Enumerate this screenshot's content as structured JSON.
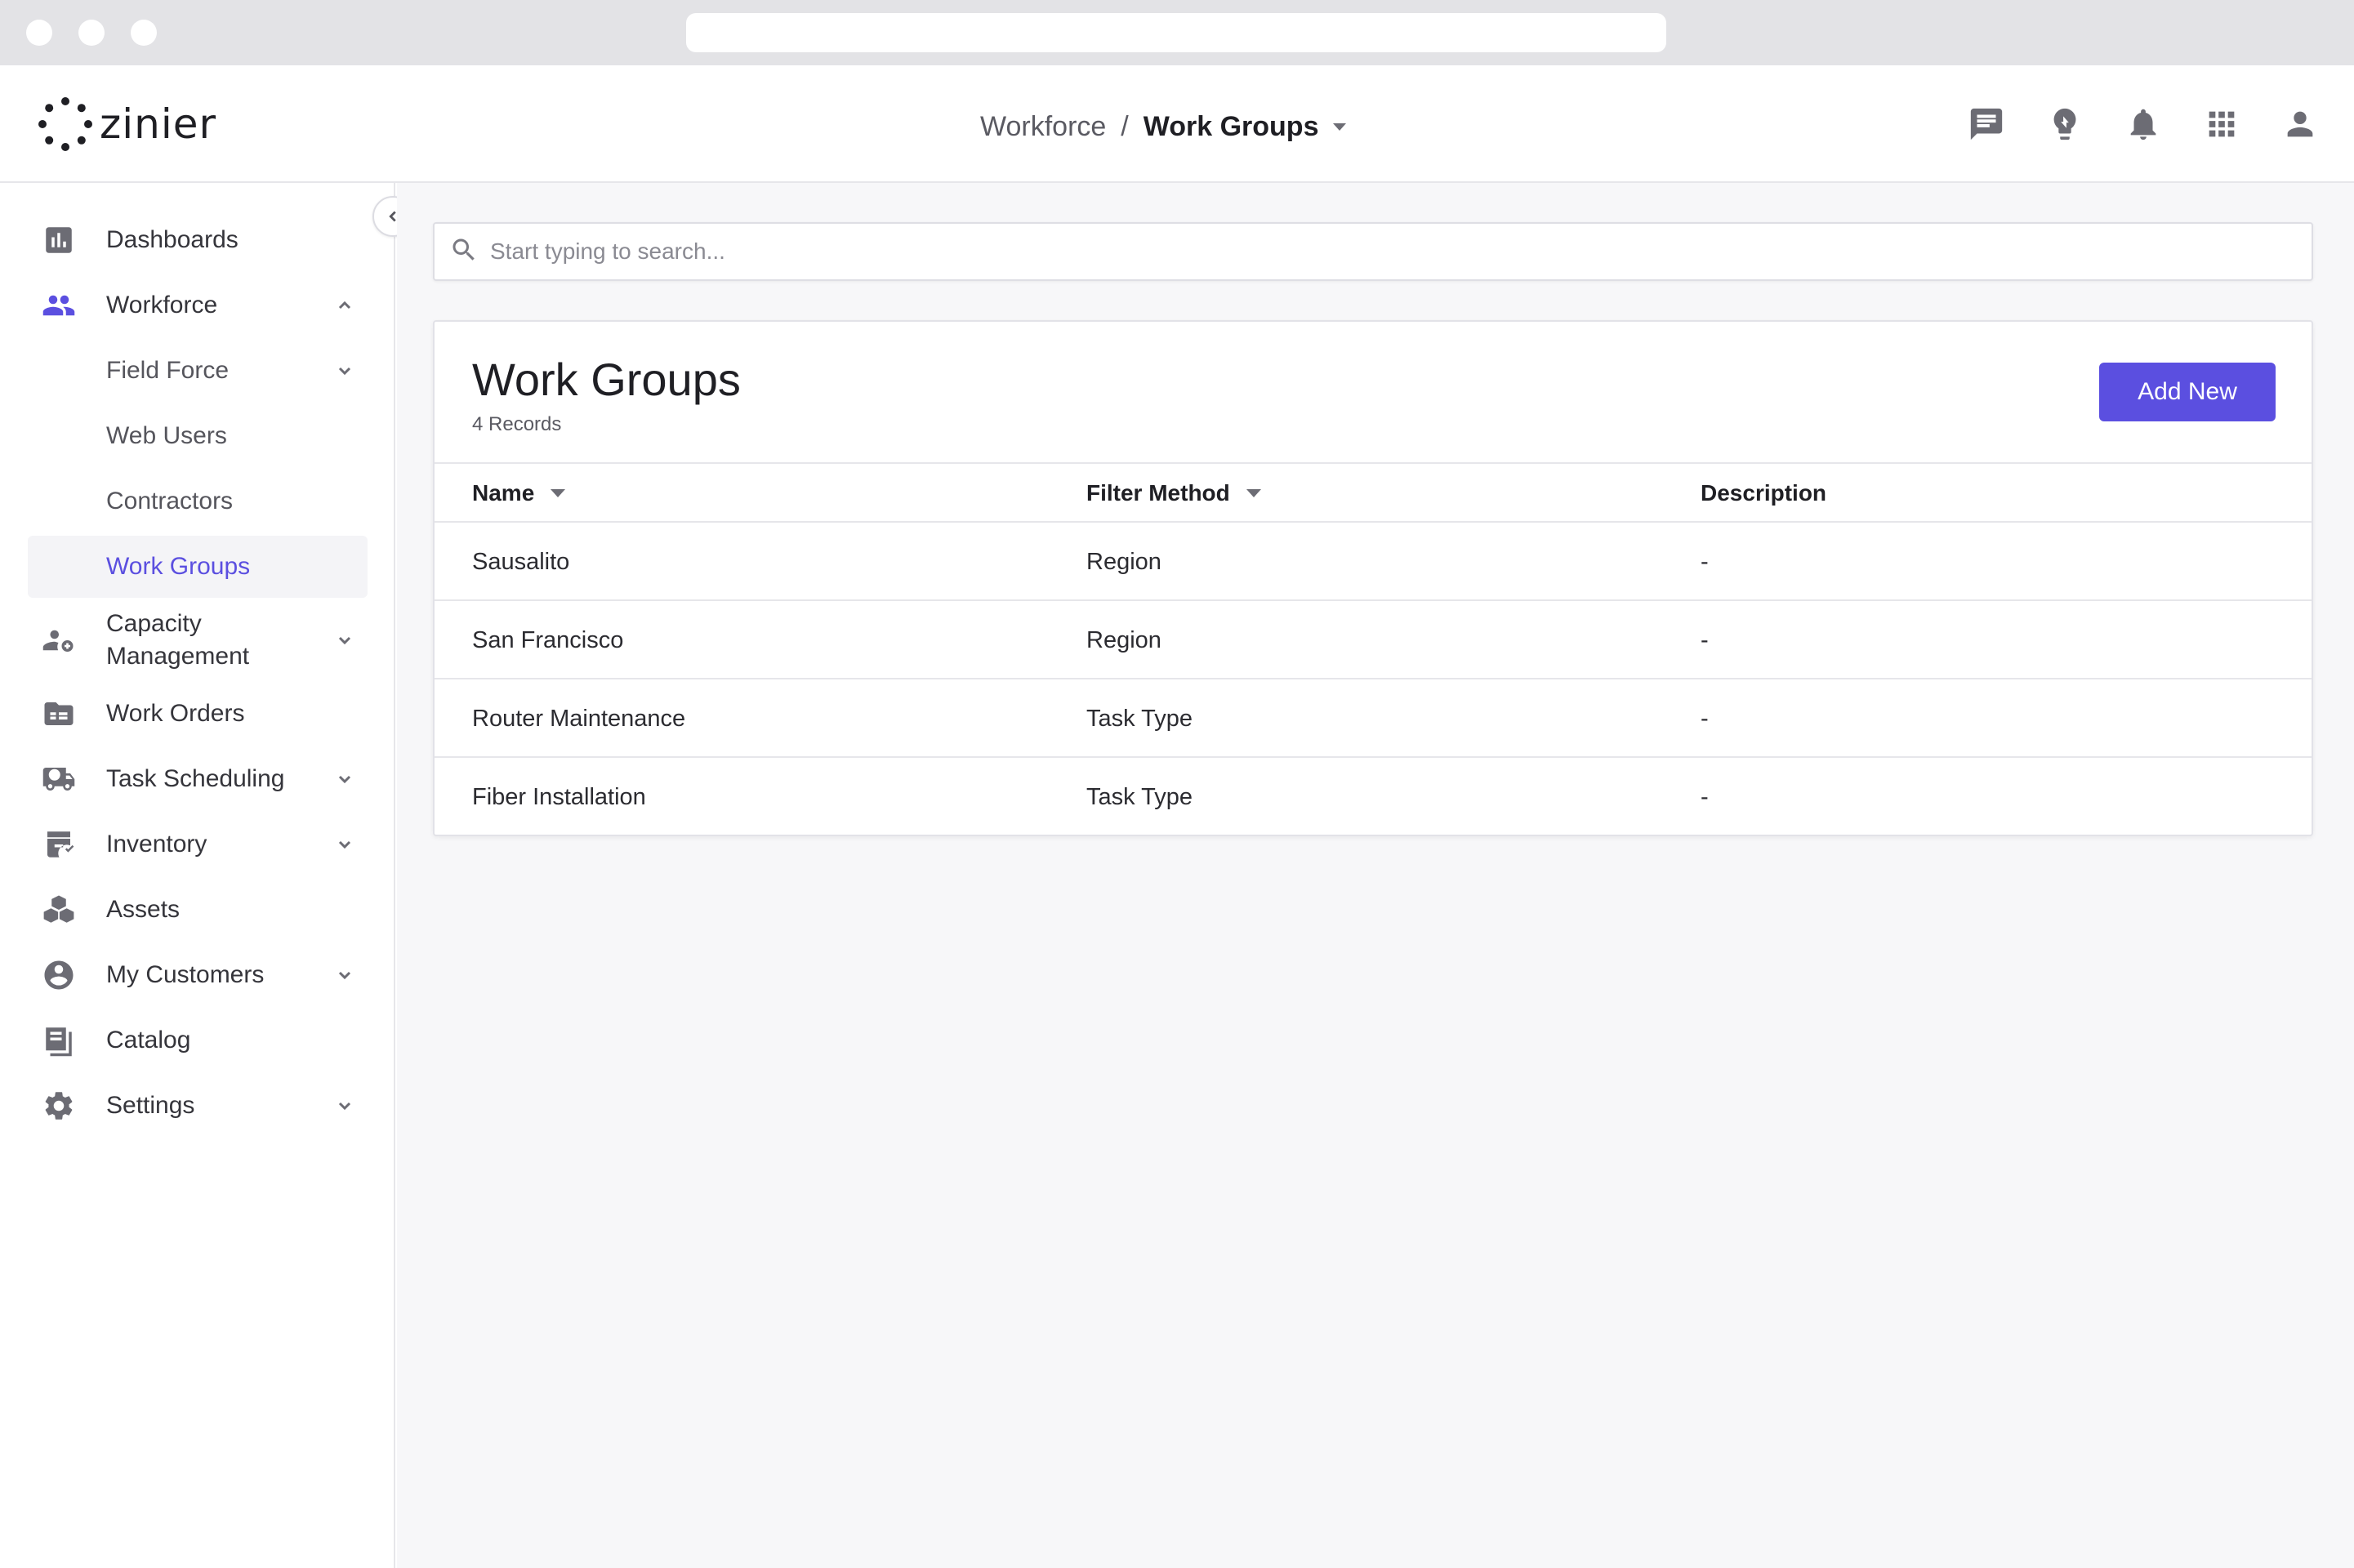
{
  "app": {
    "logo_text": "zinier"
  },
  "header": {
    "breadcrumb_parent": "Workforce",
    "breadcrumb_separator": "/",
    "breadcrumb_current": "Work Groups",
    "icons": [
      "chat-icon",
      "lightbulb-icon",
      "bell-icon",
      "apps-grid-icon",
      "user-icon"
    ]
  },
  "sidebar": {
    "items": [
      {
        "label": "Dashboards",
        "icon": "bar-chart-icon"
      },
      {
        "label": "Workforce",
        "icon": "people-icon",
        "expanded": true
      },
      {
        "label": "Field Force",
        "sub": true
      },
      {
        "label": "Web Users",
        "sub": true
      },
      {
        "label": "Contractors",
        "sub": true
      },
      {
        "label": "Work Groups",
        "sub": true,
        "active": true
      },
      {
        "label": "Capacity Management",
        "icon": "people-add-icon"
      },
      {
        "label": "Work Orders",
        "icon": "folder-icon"
      },
      {
        "label": "Task Scheduling",
        "icon": "truck-clock-icon"
      },
      {
        "label": "Inventory",
        "icon": "box-check-icon"
      },
      {
        "label": "Assets",
        "icon": "cubes-icon"
      },
      {
        "label": "My Customers",
        "icon": "account-circle-icon"
      },
      {
        "label": "Catalog",
        "icon": "book-icon"
      },
      {
        "label": "Settings",
        "icon": "gear-icon"
      }
    ]
  },
  "search": {
    "placeholder": "Start typing to search..."
  },
  "card": {
    "title": "Work Groups",
    "records": "4 Records",
    "add_button": "Add New"
  },
  "table": {
    "columns": [
      "Name",
      "Filter Method",
      "Description"
    ],
    "rows": [
      {
        "name": "Sausalito",
        "filter": "Region",
        "description": "-"
      },
      {
        "name": "San Francisco",
        "filter": "Region",
        "description": "-"
      },
      {
        "name": "Router Maintenance",
        "filter": "Task Type",
        "description": "-"
      },
      {
        "name": "Fiber Installation",
        "filter": "Task Type",
        "description": "-"
      }
    ]
  },
  "colors": {
    "accent": "#5b4fe0",
    "icon_gray": "#6c6c74",
    "background": "#f7f7f9"
  }
}
